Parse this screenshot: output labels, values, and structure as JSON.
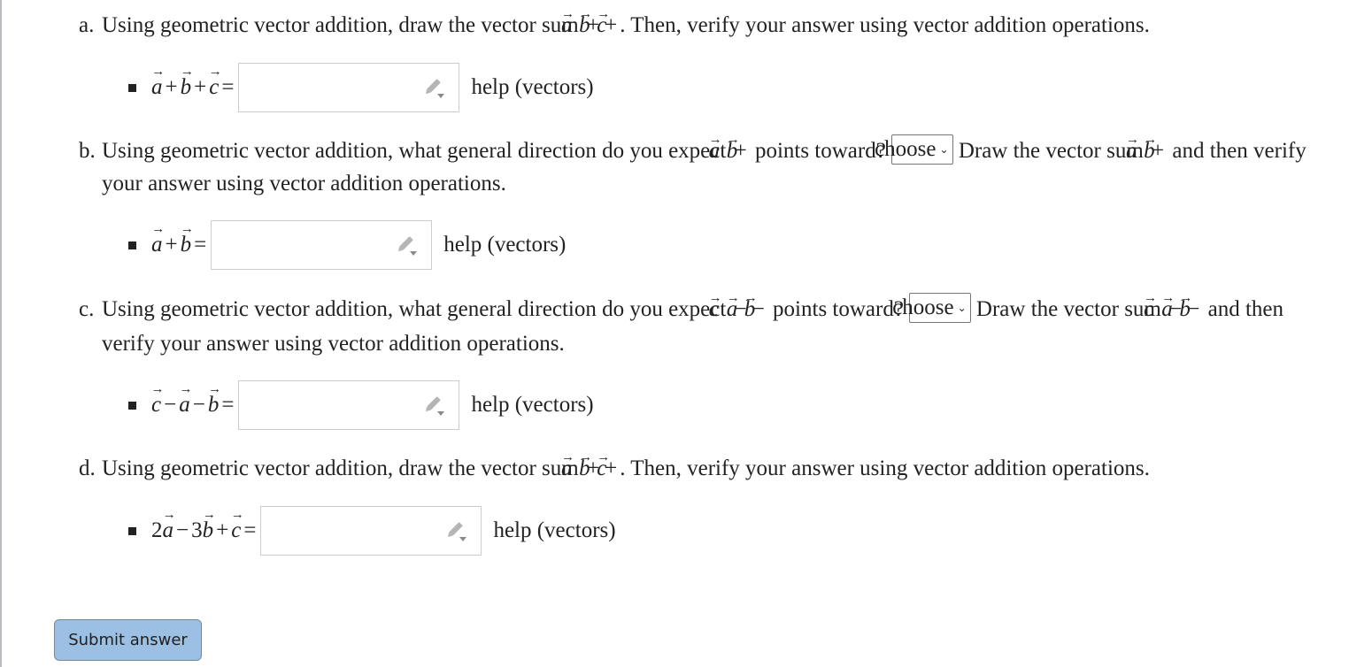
{
  "parts": [
    {
      "label": "a.",
      "text_before": "Using geometric vector addition, draw the vector sum",
      "text_after": ". Then, verify your answer using vector addition operations.",
      "answer_help": "help (vectors)",
      "answer_value": ""
    },
    {
      "label": "b.",
      "text_before": "Using geometric vector addition, what general direction do you expect",
      "text_mid": "points toward?",
      "select_value": "choose",
      "text_draw": "Draw the vector sum",
      "text_after": "and then verify your answer using vector addition operations.",
      "answer_help": "help (vectors)",
      "answer_value": ""
    },
    {
      "label": "c.",
      "text_before": "Using geometric vector addition, what general direction do you expect",
      "text_mid": "points toward?",
      "select_value": "choose",
      "text_draw": "Draw the vector sum",
      "text_after": "and then verify your answer using vector addition operations.",
      "answer_help": "help (vectors)",
      "answer_value": ""
    },
    {
      "label": "d.",
      "text_before": "Using geometric vector addition, draw the vector sum",
      "text_after": ". Then, verify your answer using vector addition operations.",
      "answer_help": "help (vectors)",
      "answer_value": ""
    }
  ],
  "math": {
    "a": "a",
    "b": "b",
    "c": "c",
    "plus": "+",
    "minus": "−",
    "equals": "=",
    "coef_2": "2",
    "coef_3": "3"
  },
  "icons": {
    "answer_tool": "pencil-dropdown-icon",
    "select_caret": "chevron-down-icon"
  },
  "submit": {
    "label": "Submit answer",
    "color": "#9cc0e3"
  }
}
